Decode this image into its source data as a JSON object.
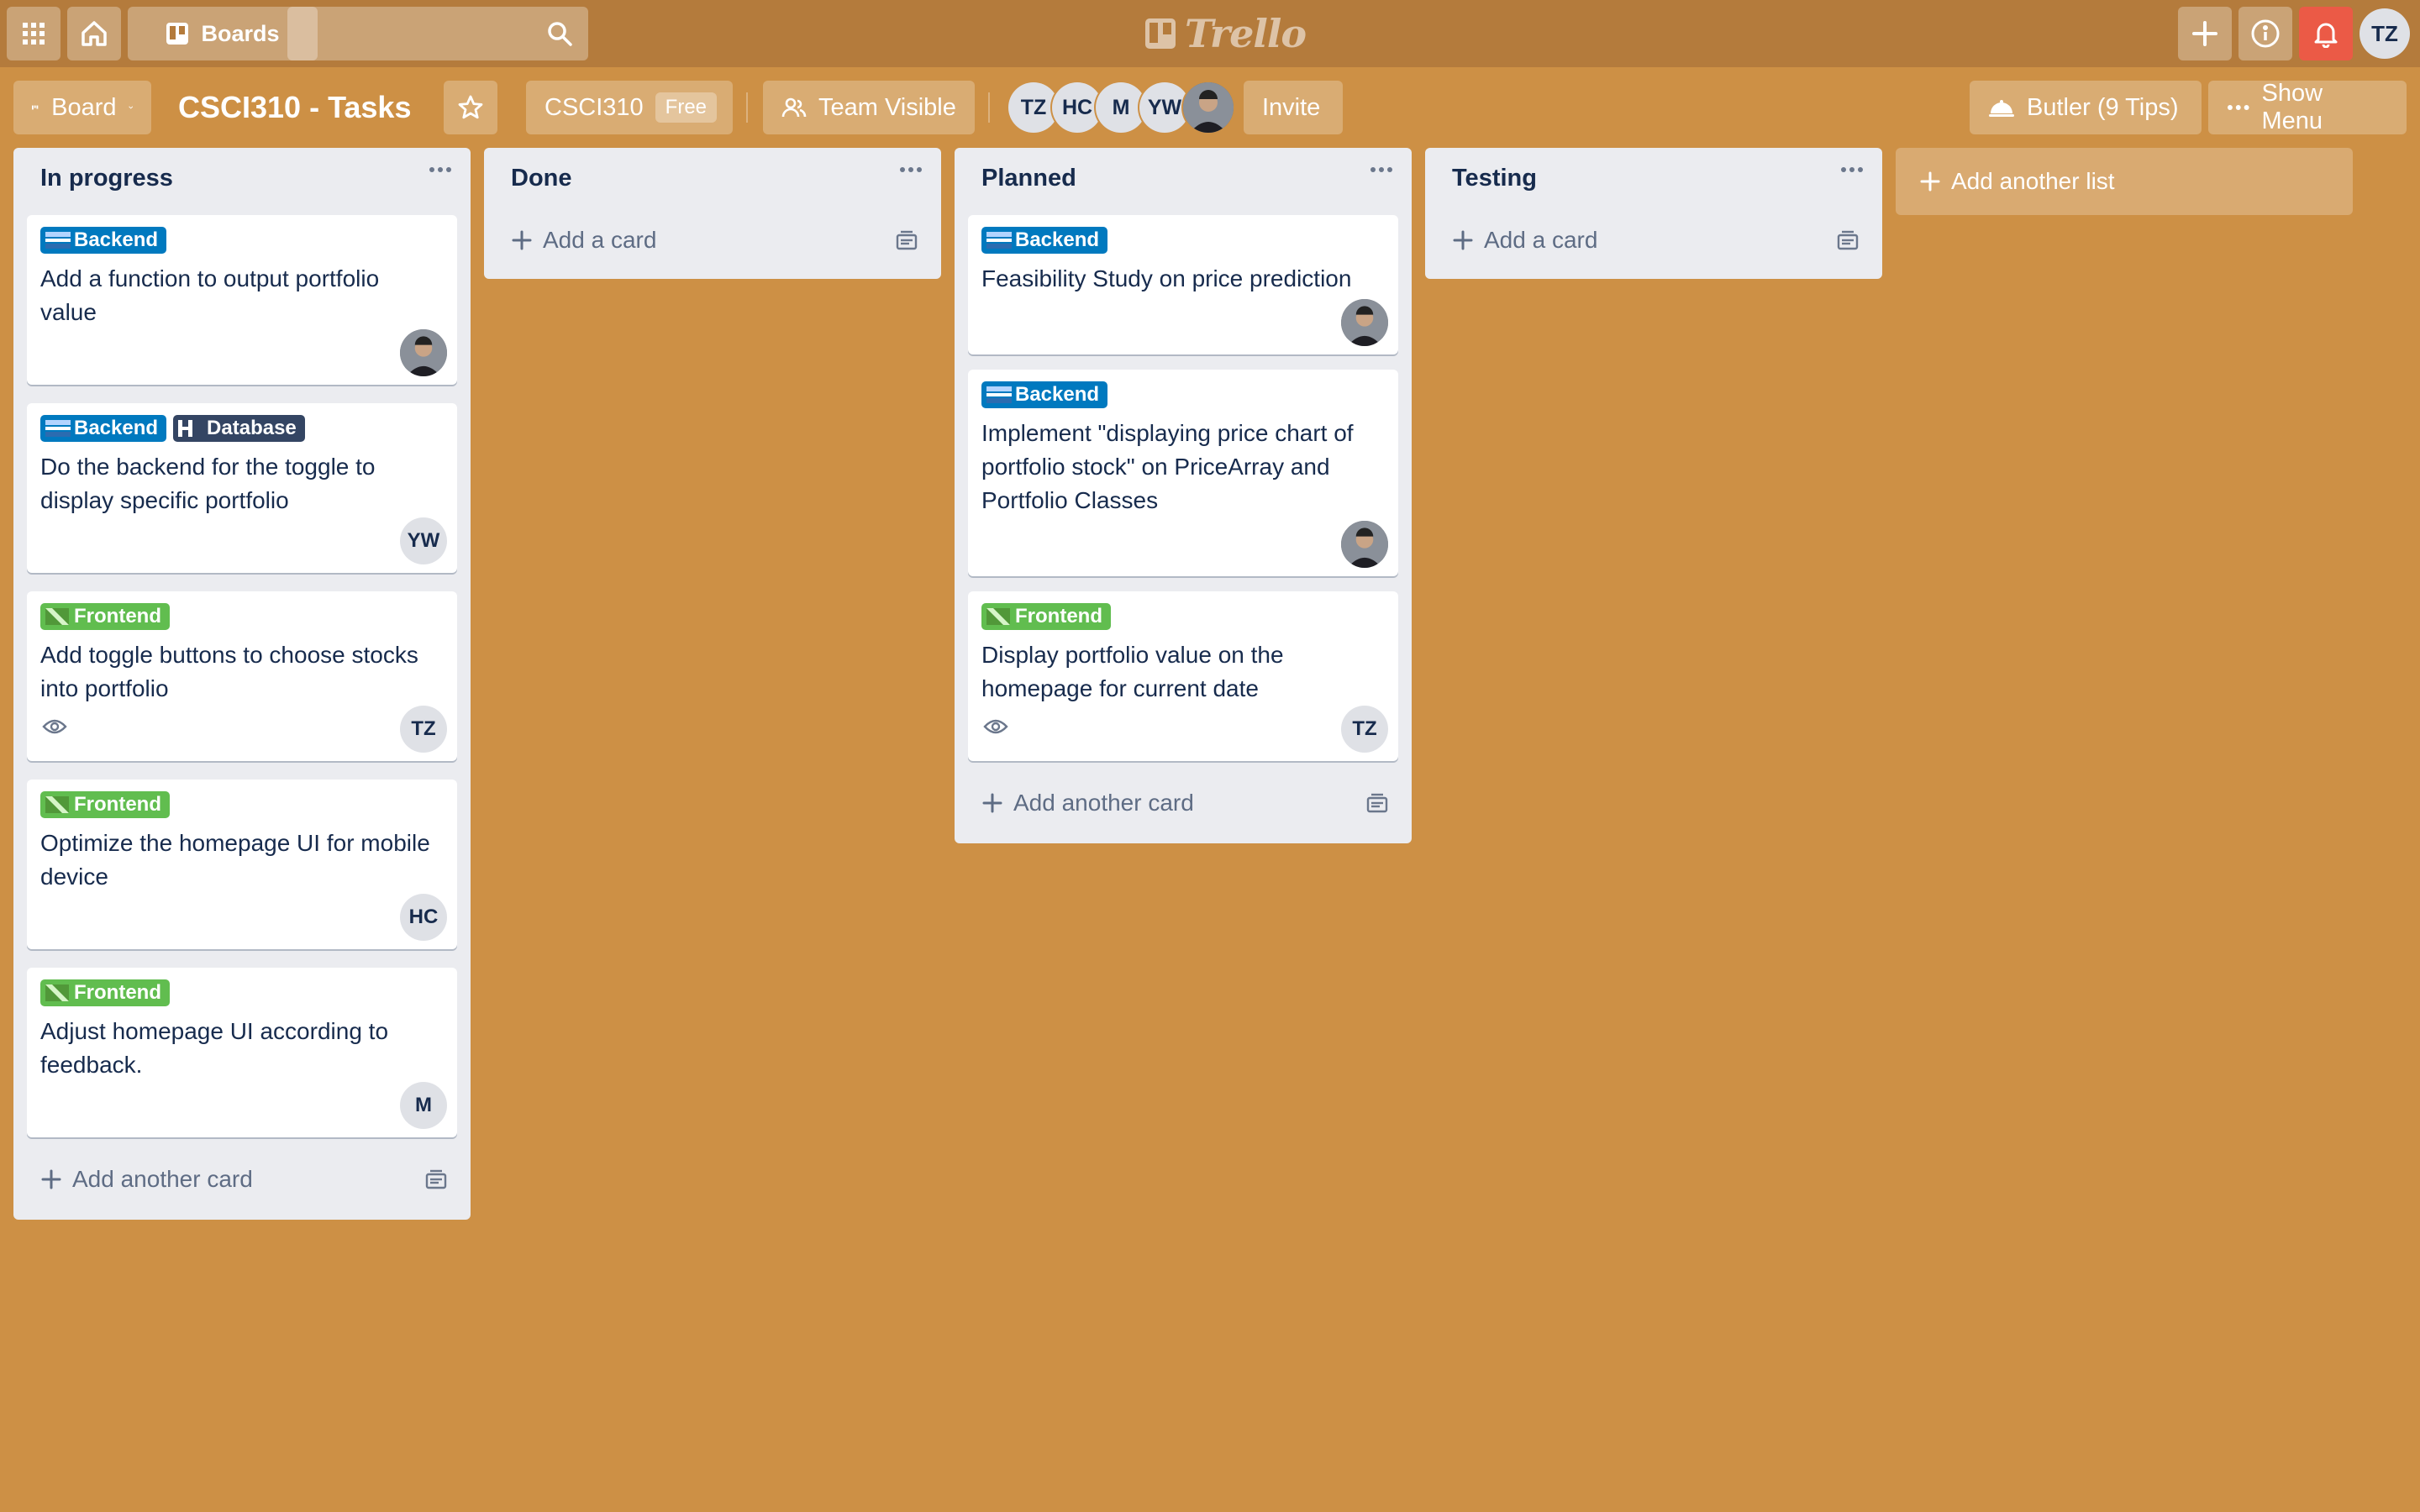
{
  "topnav": {
    "boards_label": "Boards",
    "search_placeholder": "",
    "logo_text": "Trello",
    "user_initials": "TZ"
  },
  "board_header": {
    "view_label": "Board",
    "title": "CSCI310 - Tasks",
    "team_name": "CSCI310",
    "team_badge": "Free",
    "visibility_label": "Team Visible",
    "members": [
      "TZ",
      "HC",
      "M",
      "YW"
    ],
    "invite_label": "Invite",
    "butler_label": "Butler (9 Tips)",
    "menu_label": "Show Menu"
  },
  "lists": [
    {
      "title": "In progress",
      "add_label": "Add another card",
      "cards": [
        {
          "labels": [
            "Backend"
          ],
          "title": "Add a function to output portfolio value",
          "assignee": "photo"
        },
        {
          "labels": [
            "Backend",
            "Database"
          ],
          "title": "Do the backend for the toggle to display specific portfolio",
          "assignee": "YW"
        },
        {
          "labels": [
            "Frontend"
          ],
          "title": "Add toggle buttons to choose stocks into portfolio",
          "assignee": "TZ",
          "watched": true
        },
        {
          "labels": [
            "Frontend"
          ],
          "title": "Optimize the homepage UI for mobile device",
          "assignee": "HC"
        },
        {
          "labels": [
            "Frontend"
          ],
          "title": "Adjust homepage UI according to feedback.",
          "assignee": "M"
        }
      ]
    },
    {
      "title": "Done",
      "add_label": "Add a card",
      "cards": []
    },
    {
      "title": "Planned",
      "add_label": "Add another card",
      "cards": [
        {
          "labels": [
            "Backend"
          ],
          "title": "Feasibility Study on price prediction",
          "assignee": "photo"
        },
        {
          "labels": [
            "Backend"
          ],
          "title": "Implement \"displaying price chart of portfolio stock\" on PriceArray and Portfolio Classes",
          "assignee": "photo"
        },
        {
          "labels": [
            "Frontend"
          ],
          "title": "Display portfolio value on the homepage for current date",
          "assignee": "TZ",
          "watched": true
        }
      ]
    },
    {
      "title": "Testing",
      "add_label": "Add a card",
      "cards": []
    }
  ],
  "add_list_label": "Add another list",
  "colors": {
    "background": "#cd9045",
    "label_backend": "#0079bf",
    "label_database": "#344563",
    "label_frontend": "#61bd4f",
    "notification": "#eb5a46"
  }
}
